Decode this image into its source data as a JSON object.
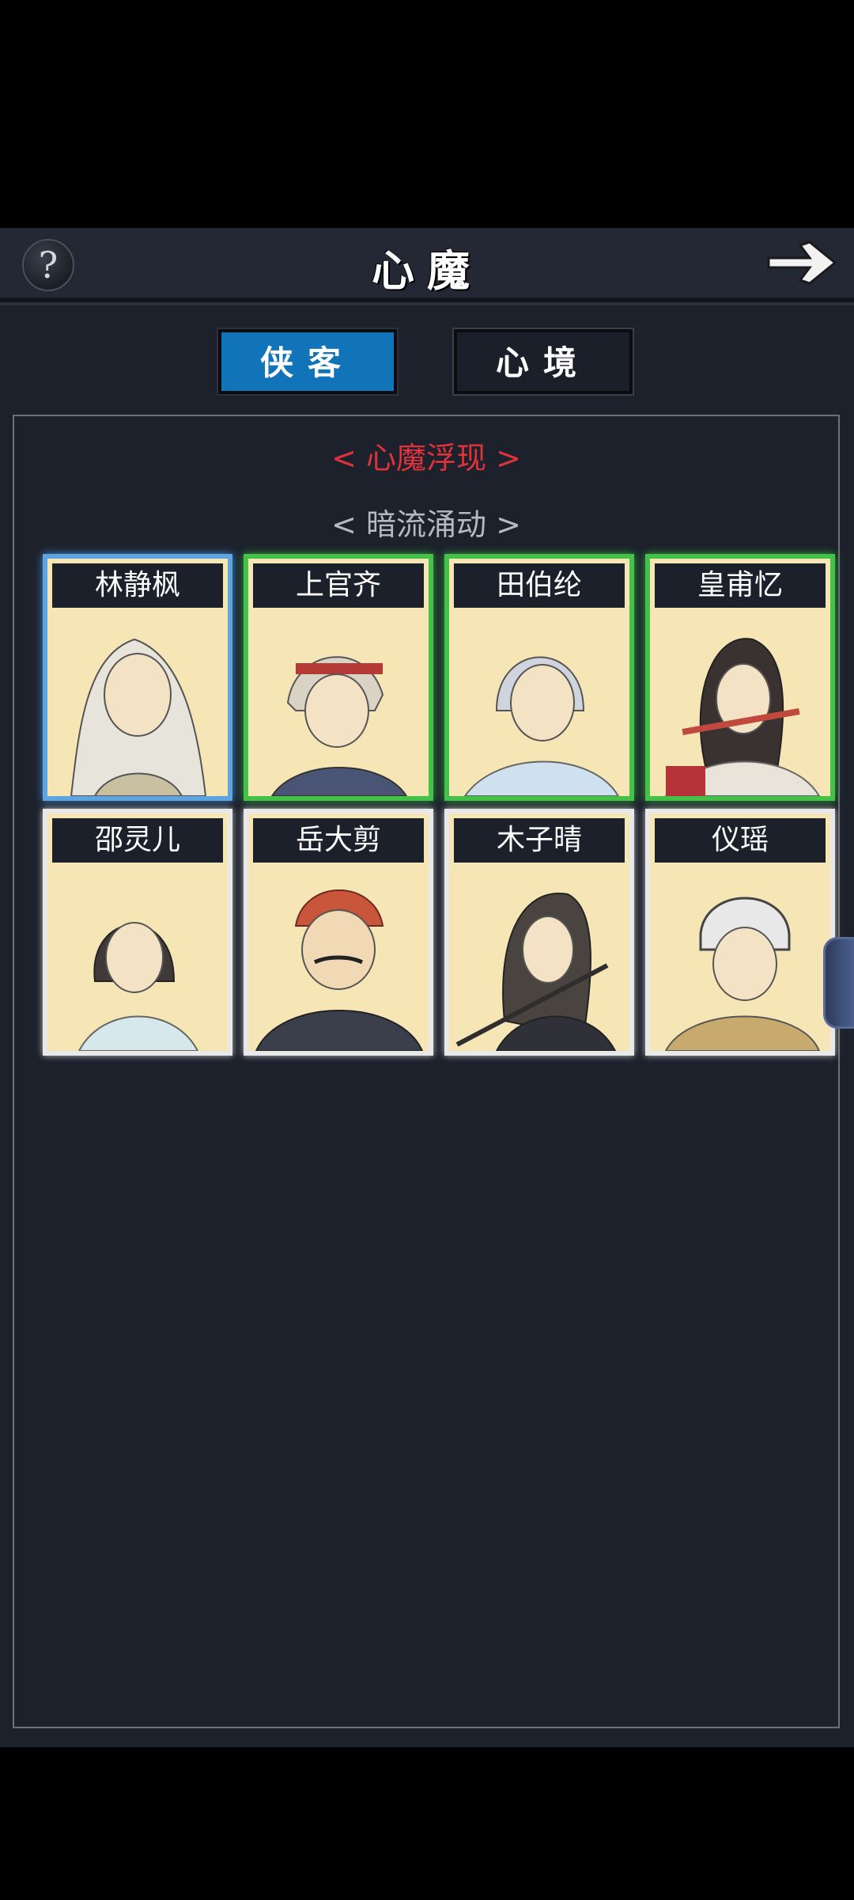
{
  "header": {
    "title": "心魔",
    "help_label": "?"
  },
  "tabs": [
    {
      "label": "侠客",
      "active": true
    },
    {
      "label": "心境",
      "active": false
    }
  ],
  "sections": {
    "emerged": "< 心魔浮现 >",
    "undercurrent": "< 暗流涌动 >"
  },
  "characters": [
    {
      "name": "林静枫",
      "rarity": "blue"
    },
    {
      "name": "上官齐",
      "rarity": "green"
    },
    {
      "name": "田伯纶",
      "rarity": "green"
    },
    {
      "name": "皇甫忆",
      "rarity": "green"
    },
    {
      "name": "邵灵儿",
      "rarity": "white"
    },
    {
      "name": "岳大剪",
      "rarity": "white"
    },
    {
      "name": "木子晴",
      "rarity": "white"
    },
    {
      "name": "仪瑶",
      "rarity": "white"
    }
  ],
  "colors": {
    "background": "#1d212c",
    "tab_active": "#1173b8",
    "section_red": "#e0323a",
    "rarity_blue": "#5fa3df",
    "rarity_green": "#45c04a",
    "rarity_white": "#e8e8e8"
  },
  "icons": {
    "help": "question-mark-icon",
    "next": "arrow-right-icon"
  }
}
